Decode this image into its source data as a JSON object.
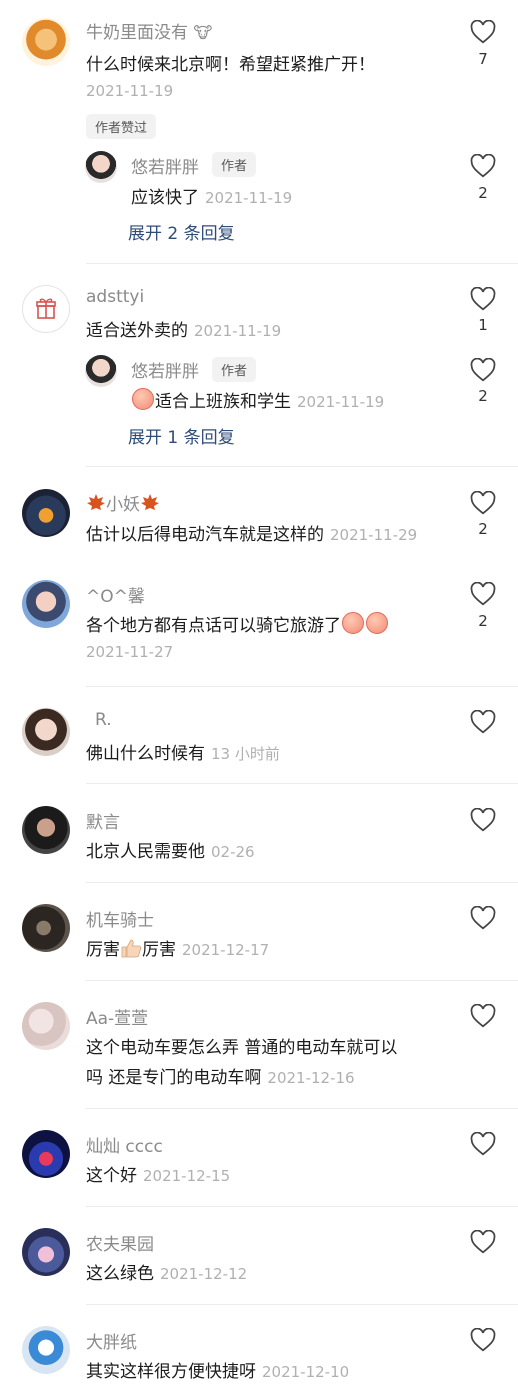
{
  "comments": [
    {
      "name": "牛奶里面没有",
      "text": "什么时候来北京啊！希望赶紧推广开！",
      "date": "2021-11-19",
      "likes": "7",
      "badge": "作者赞过",
      "reply": {
        "name": "悠若胖胖",
        "tag": "作者",
        "text": "应该快了",
        "date": "2021-11-19",
        "likes": "2"
      },
      "expand": "展开 2 条回复"
    },
    {
      "name": "adsttyi",
      "text": "适合送外卖的",
      "date": "2021-11-19",
      "likes": "1",
      "reply": {
        "name": "悠若胖胖",
        "tag": "作者",
        "text": "适合上班族和学生",
        "date": "2021-11-19",
        "likes": "2"
      },
      "expand": "展开 1 条回复"
    },
    {
      "name": "小妖",
      "text": "估计以后得电动汽车就是这样的",
      "date": "2021-11-29",
      "likes": "2"
    },
    {
      "name": "^O^馨",
      "text": "各个地方都有点话可以骑它旅游了",
      "date": "2021-11-27",
      "likes": "2"
    },
    {
      "name": "R.",
      "text": "佛山什么时候有",
      "date": "13 小时前"
    },
    {
      "name": "默言",
      "text": "北京人民需要他",
      "date": "02-26"
    },
    {
      "name": "机车骑士",
      "text_a": "厉害",
      "text_b": "厉害",
      "date": "2021-12-17"
    },
    {
      "name": "Aa-萱萱",
      "text_line1": "这个电动车要怎么弄 普通的电动车就可以",
      "text_line2": "吗 还是专门的电动车啊",
      "date": "2021-12-16"
    },
    {
      "name": "灿灿 cccc",
      "text": "这个好",
      "date": "2021-12-15"
    },
    {
      "name": "农夫果园",
      "text": "这么绿色",
      "date": "2021-12-12"
    },
    {
      "name": "大胖纸",
      "text": "其实这样很方便快捷呀",
      "date": "2021-12-10"
    }
  ],
  "icons": {
    "like": "heart-outline-icon",
    "gift": "gift-icon",
    "leaf": "maple-leaf-icon",
    "emoji": "peach-face-emoji",
    "thumb": "thumbs-up-emoji"
  },
  "colors": {
    "name": "#8a8a8a",
    "date": "#b0b0b0",
    "expand": "#2f4c79",
    "text": "#1c1c1c"
  }
}
